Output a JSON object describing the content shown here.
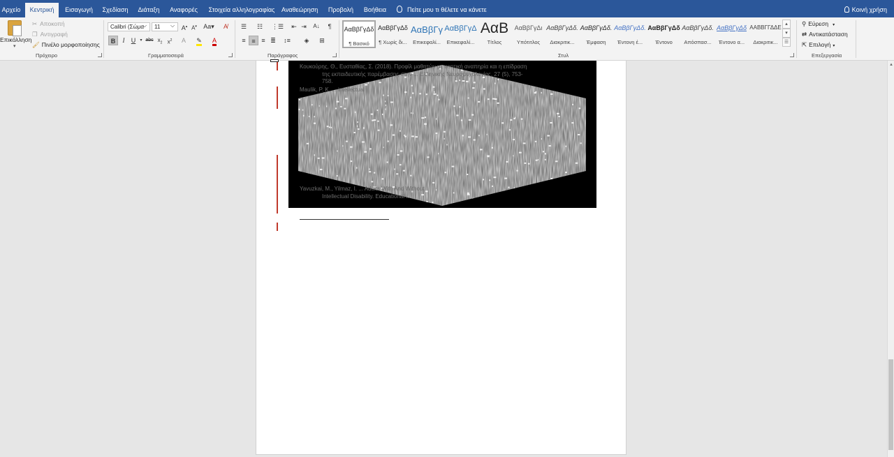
{
  "tabs": [
    {
      "label": "Αρχείο",
      "active": false
    },
    {
      "label": "Κεντρική",
      "active": true
    },
    {
      "label": "Εισαγωγή",
      "active": false
    },
    {
      "label": "Σχεδίαση",
      "active": false
    },
    {
      "label": "Διάταξη",
      "active": false
    },
    {
      "label": "Αναφορές",
      "active": false
    },
    {
      "label": "Στοιχεία αλληλογραφίας",
      "active": false
    },
    {
      "label": "Αναθεώρηση",
      "active": false
    },
    {
      "label": "Προβολή",
      "active": false
    },
    {
      "label": "Βοήθεια",
      "active": false
    }
  ],
  "tell_me": "Πείτε μου τι θέλετε να κάνετε",
  "share": "Κοινή χρήση",
  "clipboard": {
    "paste": "Επικόλληση",
    "cut": "Αποκοπή",
    "copy": "Αντιγραφή",
    "format_painter": "Πινέλο μορφοποίησης",
    "group_label": "Πρόχειρο"
  },
  "font": {
    "family": "Calibri (Σώμα",
    "size": "11",
    "group_label": "Γραμματοσειρά"
  },
  "paragraph": {
    "group_label": "Παράγραφος"
  },
  "styles": {
    "group_label": "Στυλ",
    "items": [
      {
        "sample": "ΑαΒβΓγΔδ",
        "name": "¶ Βασικό",
        "selected": true
      },
      {
        "sample": "ΑαΒβΓγΔδ",
        "name": "¶ Χωρίς δι...",
        "selected": false
      },
      {
        "sample": "ΑαΒβΓγ",
        "name": "Επικεφαλί...",
        "selected": false
      },
      {
        "sample": "ΑαΒβΓγΔ",
        "name": "Επικεφαλί...",
        "selected": false
      },
      {
        "sample": "ΑαΒ",
        "name": "Τίτλος",
        "selected": false
      },
      {
        "sample": "ΑαΒβΓγΔι",
        "name": "Υπότιτλος",
        "selected": false
      },
      {
        "sample": "ΑαΒβΓγΔδ.",
        "name": "Διακριτικ...",
        "selected": false
      },
      {
        "sample": "ΑαΒβΓγΔδ.",
        "name": "Έμφαση",
        "selected": false
      },
      {
        "sample": "ΑαΒβΓγΔδ.",
        "name": "Έντονη έ...",
        "selected": false
      },
      {
        "sample": "ΑαΒβΓγΔδ",
        "name": "Έντονο",
        "selected": false
      },
      {
        "sample": "ΑαΒβΓγΔδ.",
        "name": "Απόσπασ...",
        "selected": false
      },
      {
        "sample": "ΑαΒβΓγΔδ",
        "name": "Έντονο α...",
        "selected": false
      },
      {
        "sample": "ΑΑΒΒΓΓΔΔΕ",
        "name": "Διακριτικ...",
        "selected": false
      }
    ]
  },
  "editing": {
    "find": "Εύρεση",
    "replace": "Αντικατάσταση",
    "select": "Επιλογή",
    "group_label": "Επεξεργασία"
  },
  "document": {
    "ref_lines": [
      "Κουκούρης, Θ., Ευσταθίας, Σ. (2018). Προφίλ μαθητών με νοητική αναπηρία και η επίδραση",
      "της εκπαιδευτικής παρέμβασης στην ... Ελληνικής Νευροψυχολογίας, 27 (5), 753-",
      "758.",
      "Maulik, P. K. ... intellectual",
      "Yavuzkai, M., Yilmaz, I. ... Adults With And Without",
      "Intellectual Disability. Educational ..."
    ]
  },
  "colors": {
    "tab_bar": "#2b579a",
    "ribbon": "#f3f3f3",
    "canvas": "#e6e6e6",
    "page": "#ffffff",
    "change_bar": "#c0392b",
    "picture_bg": "#000000"
  }
}
